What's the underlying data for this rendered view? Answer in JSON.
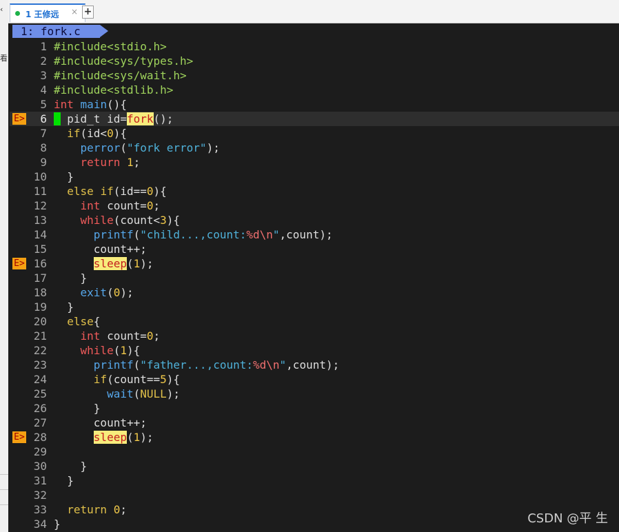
{
  "tab": {
    "title": "1 王修远",
    "close_glyph": "×",
    "new_tab_glyph": "+"
  },
  "left_strip": {
    "glyphs": [
      "‹",
      "看"
    ]
  },
  "editor": {
    "buffer_label": "1: fork.c",
    "sign_text": "E>",
    "lines": [
      {
        "n": "1",
        "segs": [
          {
            "t": "#include<stdio.h>",
            "c": "pp"
          }
        ]
      },
      {
        "n": "2",
        "segs": [
          {
            "t": "#include<sys/types.h>",
            "c": "pp"
          }
        ]
      },
      {
        "n": "3",
        "segs": [
          {
            "t": "#include<sys/wait.h>",
            "c": "pp"
          }
        ]
      },
      {
        "n": "4",
        "segs": [
          {
            "t": "#include<stdlib.h>",
            "c": "pp"
          }
        ]
      },
      {
        "n": "5",
        "segs": [
          {
            "t": "int",
            "c": "kw"
          },
          {
            "t": " ",
            "c": "plain"
          },
          {
            "t": "main",
            "c": "fn"
          },
          {
            "t": "(){",
            "c": "plain"
          }
        ]
      },
      {
        "n": "6",
        "sign": true,
        "current": true,
        "cursor": true,
        "segs": [
          {
            "t": "  pid_t id=",
            "c": "plain"
          },
          {
            "t": "fork",
            "c": "hl"
          },
          {
            "t": "();",
            "c": "plain"
          }
        ]
      },
      {
        "n": "7",
        "segs": [
          {
            "t": "  ",
            "c": "plain"
          },
          {
            "t": "if",
            "c": "kw2"
          },
          {
            "t": "(id<",
            "c": "plain"
          },
          {
            "t": "0",
            "c": "num"
          },
          {
            "t": "){",
            "c": "plain"
          }
        ]
      },
      {
        "n": "8",
        "segs": [
          {
            "t": "    ",
            "c": "plain"
          },
          {
            "t": "perror",
            "c": "fn"
          },
          {
            "t": "(",
            "c": "plain"
          },
          {
            "t": "\"fork error\"",
            "c": "str"
          },
          {
            "t": ");",
            "c": "plain"
          }
        ]
      },
      {
        "n": "9",
        "segs": [
          {
            "t": "    ",
            "c": "plain"
          },
          {
            "t": "return",
            "c": "kw"
          },
          {
            "t": " ",
            "c": "plain"
          },
          {
            "t": "1",
            "c": "num"
          },
          {
            "t": ";",
            "c": "plain"
          }
        ]
      },
      {
        "n": "10",
        "segs": [
          {
            "t": "  }",
            "c": "plain"
          }
        ]
      },
      {
        "n": "11",
        "segs": [
          {
            "t": "  ",
            "c": "plain"
          },
          {
            "t": "else",
            "c": "kw2"
          },
          {
            "t": " ",
            "c": "plain"
          },
          {
            "t": "if",
            "c": "kw2"
          },
          {
            "t": "(id==",
            "c": "plain"
          },
          {
            "t": "0",
            "c": "num"
          },
          {
            "t": "){",
            "c": "plain"
          }
        ]
      },
      {
        "n": "12",
        "segs": [
          {
            "t": "    ",
            "c": "plain"
          },
          {
            "t": "int",
            "c": "kw"
          },
          {
            "t": " count=",
            "c": "plain"
          },
          {
            "t": "0",
            "c": "num"
          },
          {
            "t": ";",
            "c": "plain"
          }
        ]
      },
      {
        "n": "13",
        "segs": [
          {
            "t": "    ",
            "c": "plain"
          },
          {
            "t": "while",
            "c": "kw"
          },
          {
            "t": "(count<",
            "c": "plain"
          },
          {
            "t": "3",
            "c": "num"
          },
          {
            "t": "){",
            "c": "plain"
          }
        ]
      },
      {
        "n": "14",
        "segs": [
          {
            "t": "      ",
            "c": "plain"
          },
          {
            "t": "printf",
            "c": "fn"
          },
          {
            "t": "(",
            "c": "plain"
          },
          {
            "t": "\"child...,count:",
            "c": "str"
          },
          {
            "t": "%d\\n",
            "c": "fmt"
          },
          {
            "t": "\"",
            "c": "str"
          },
          {
            "t": ",count);",
            "c": "plain"
          }
        ]
      },
      {
        "n": "15",
        "segs": [
          {
            "t": "      count++;",
            "c": "plain"
          }
        ]
      },
      {
        "n": "16",
        "sign": true,
        "segs": [
          {
            "t": "      ",
            "c": "plain"
          },
          {
            "t": "sleep",
            "c": "hl"
          },
          {
            "t": "(",
            "c": "plain"
          },
          {
            "t": "1",
            "c": "num"
          },
          {
            "t": ");",
            "c": "plain"
          }
        ]
      },
      {
        "n": "17",
        "segs": [
          {
            "t": "    }",
            "c": "plain"
          }
        ]
      },
      {
        "n": "18",
        "segs": [
          {
            "t": "    ",
            "c": "plain"
          },
          {
            "t": "exit",
            "c": "fn"
          },
          {
            "t": "(",
            "c": "plain"
          },
          {
            "t": "0",
            "c": "num"
          },
          {
            "t": ");",
            "c": "plain"
          }
        ]
      },
      {
        "n": "19",
        "segs": [
          {
            "t": "  }",
            "c": "plain"
          }
        ]
      },
      {
        "n": "20",
        "segs": [
          {
            "t": "  ",
            "c": "plain"
          },
          {
            "t": "else",
            "c": "kw2"
          },
          {
            "t": "{",
            "c": "plain"
          }
        ]
      },
      {
        "n": "21",
        "segs": [
          {
            "t": "    ",
            "c": "plain"
          },
          {
            "t": "int",
            "c": "kw"
          },
          {
            "t": " count=",
            "c": "plain"
          },
          {
            "t": "0",
            "c": "num"
          },
          {
            "t": ";",
            "c": "plain"
          }
        ]
      },
      {
        "n": "22",
        "segs": [
          {
            "t": "    ",
            "c": "plain"
          },
          {
            "t": "while",
            "c": "kw"
          },
          {
            "t": "(",
            "c": "plain"
          },
          {
            "t": "1",
            "c": "num"
          },
          {
            "t": "){",
            "c": "plain"
          }
        ]
      },
      {
        "n": "23",
        "segs": [
          {
            "t": "      ",
            "c": "plain"
          },
          {
            "t": "printf",
            "c": "fn"
          },
          {
            "t": "(",
            "c": "plain"
          },
          {
            "t": "\"father...,count:",
            "c": "str"
          },
          {
            "t": "%d\\n",
            "c": "fmt"
          },
          {
            "t": "\"",
            "c": "str"
          },
          {
            "t": ",count);",
            "c": "plain"
          }
        ]
      },
      {
        "n": "24",
        "segs": [
          {
            "t": "      ",
            "c": "plain"
          },
          {
            "t": "if",
            "c": "kw2"
          },
          {
            "t": "(count==",
            "c": "plain"
          },
          {
            "t": "5",
            "c": "num"
          },
          {
            "t": "){",
            "c": "plain"
          }
        ]
      },
      {
        "n": "25",
        "segs": [
          {
            "t": "        ",
            "c": "plain"
          },
          {
            "t": "wait",
            "c": "fn"
          },
          {
            "t": "(",
            "c": "plain"
          },
          {
            "t": "NULL",
            "c": "kw2"
          },
          {
            "t": ");",
            "c": "plain"
          }
        ]
      },
      {
        "n": "26",
        "segs": [
          {
            "t": "      }",
            "c": "plain"
          }
        ]
      },
      {
        "n": "27",
        "segs": [
          {
            "t": "      count++;",
            "c": "plain"
          }
        ]
      },
      {
        "n": "28",
        "sign": true,
        "segs": [
          {
            "t": "      ",
            "c": "plain"
          },
          {
            "t": "sleep",
            "c": "hl"
          },
          {
            "t": "(",
            "c": "plain"
          },
          {
            "t": "1",
            "c": "num"
          },
          {
            "t": ");",
            "c": "plain"
          }
        ]
      },
      {
        "n": "29",
        "segs": []
      },
      {
        "n": "30",
        "segs": [
          {
            "t": "    }",
            "c": "plain"
          }
        ]
      },
      {
        "n": "31",
        "segs": [
          {
            "t": "  }",
            "c": "plain"
          }
        ]
      },
      {
        "n": "32",
        "segs": []
      },
      {
        "n": "33",
        "segs": [
          {
            "t": "  ",
            "c": "plain"
          },
          {
            "t": "return",
            "c": "kw2"
          },
          {
            "t": " ",
            "c": "plain"
          },
          {
            "t": "0",
            "c": "num"
          },
          {
            "t": ";",
            "c": "plain"
          }
        ]
      },
      {
        "n": "34",
        "segs": [
          {
            "t": "}",
            "c": "plain"
          }
        ]
      }
    ]
  },
  "watermark": "CSDN @平  生"
}
